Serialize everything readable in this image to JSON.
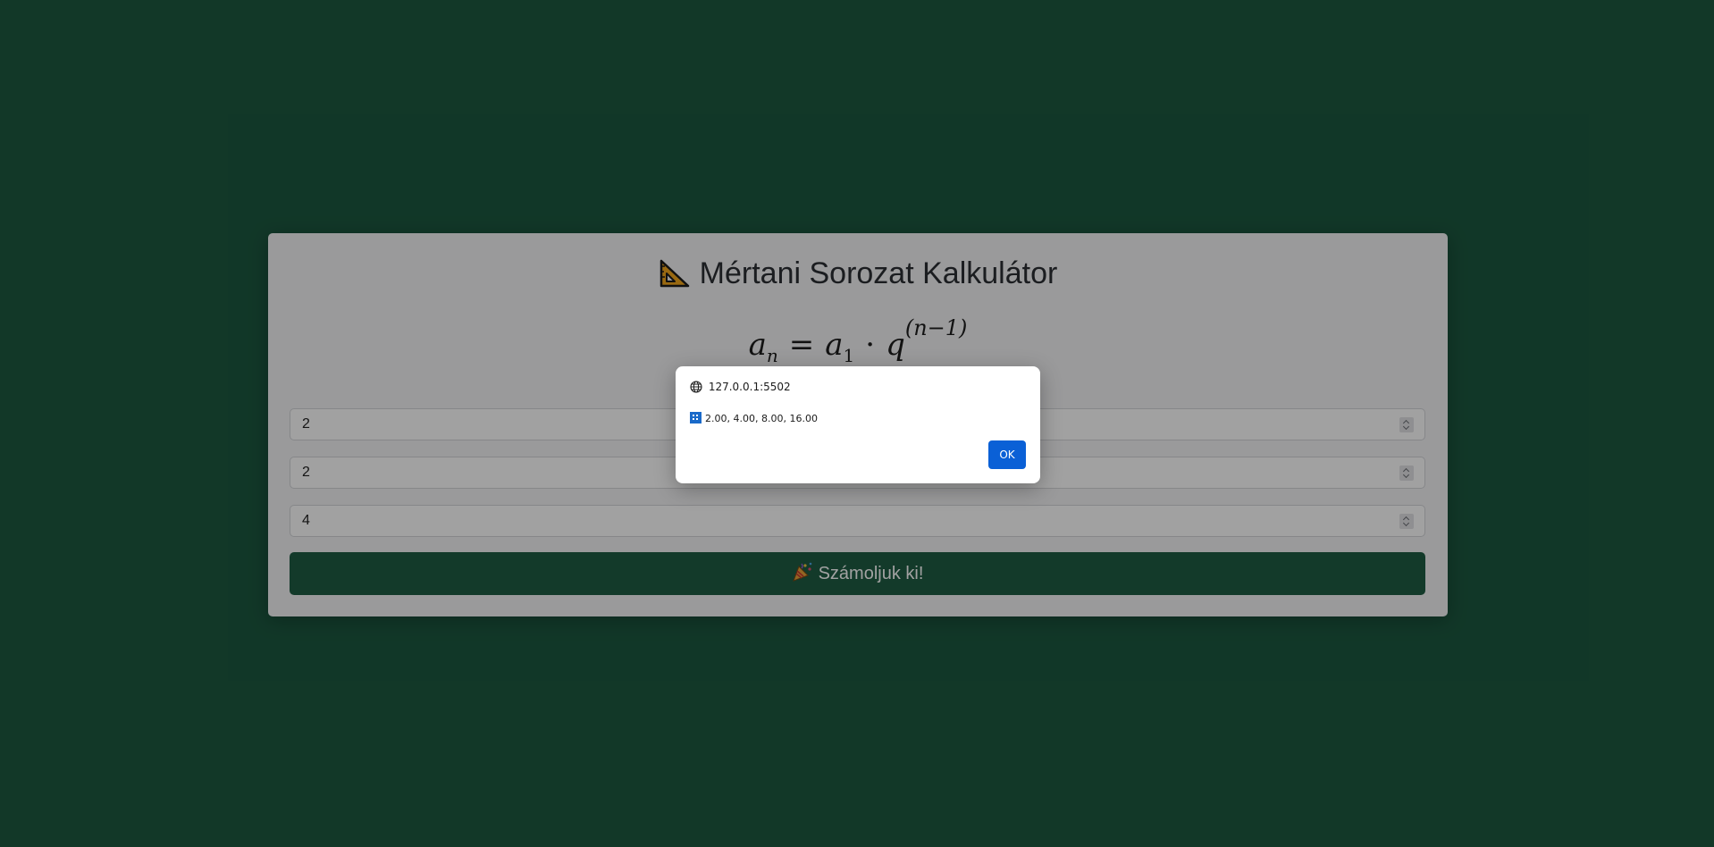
{
  "calculator": {
    "title": "Mértani Sorozat Kalkulátor",
    "title_icon": "triangular-ruler-icon",
    "formula": {
      "lhs": "a",
      "lhs_sub": "n",
      "equals": "=",
      "a1": "a",
      "a1_sub": "1",
      "dot": "·",
      "q": "q",
      "exponent": "(n−1)"
    },
    "fields": [
      {
        "value": "2"
      },
      {
        "value": "2"
      },
      {
        "value": "4"
      }
    ],
    "submit_label": "Számoljuk ki!",
    "submit_icon": "party-popper-icon"
  },
  "colors": {
    "background": "#1c5840",
    "button": "#1f5d43",
    "dialog_ok": "#0a60d6"
  },
  "alert_dialog": {
    "origin": "127.0.0.1:5502",
    "origin_icon": "globe-icon",
    "message_icon": "numbers-icon",
    "message": "2.00, 4.00, 8.00, 16.00",
    "ok_label": "OK"
  }
}
